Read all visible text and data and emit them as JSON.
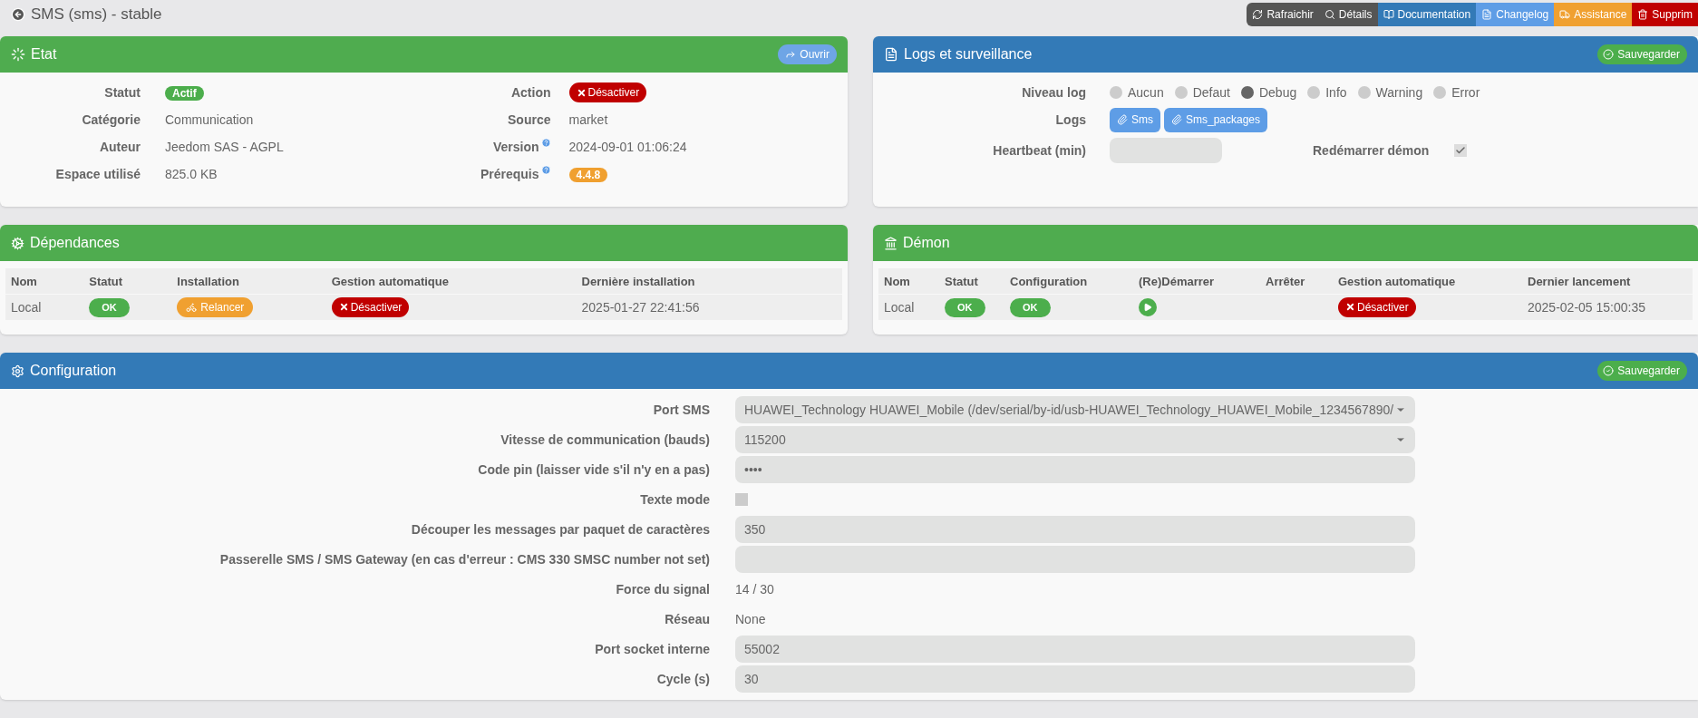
{
  "page": {
    "title": "SMS (sms) - stable"
  },
  "toolbar": [
    "Rafraichir",
    "Détails",
    "Documentation",
    "Changelog",
    "Assistance",
    "Supprim"
  ],
  "etat": {
    "title": "Etat",
    "open_button": "Ouvrir",
    "left": [
      {
        "label": "Statut",
        "value": "Actif",
        "kind": "badge-green"
      },
      {
        "label": "Catégorie",
        "value": "Communication",
        "kind": "text"
      },
      {
        "label": "Auteur",
        "value": "Jeedom SAS - AGPL",
        "kind": "text"
      },
      {
        "label": "Espace utilisé",
        "value": "825.0 KB",
        "kind": "text"
      }
    ],
    "right": [
      {
        "label": "Action",
        "value": "Désactiver",
        "kind": "button-red",
        "help": false
      },
      {
        "label": "Source",
        "value": "market",
        "kind": "text",
        "help": false
      },
      {
        "label": "Version",
        "value": "2024-09-01 01:06:24",
        "kind": "text",
        "help": true
      },
      {
        "label": "Prérequis",
        "value": "4.4.8",
        "kind": "badge-orange",
        "help": true
      }
    ]
  },
  "logs": {
    "title": "Logs et surveillance",
    "save_button": "Sauvegarder",
    "level_label": "Niveau log",
    "levels": [
      {
        "label": "Aucun",
        "selected": false
      },
      {
        "label": "Defaut",
        "selected": false
      },
      {
        "label": "Debug",
        "selected": true
      },
      {
        "label": "Info",
        "selected": false
      },
      {
        "label": "Warning",
        "selected": false
      },
      {
        "label": "Error",
        "selected": false
      }
    ],
    "logs_label": "Logs",
    "log_buttons": [
      "Sms",
      "Sms_packages"
    ],
    "heartbeat_label": "Heartbeat (min)",
    "restart_label": "Redémarrer démon",
    "restart_checked": true
  },
  "dependances": {
    "title": "Dépendances",
    "columns": [
      "Nom",
      "Statut",
      "Installation",
      "Gestion automatique",
      "Dernière installation"
    ],
    "row": [
      {
        "kind": "text",
        "value": "Local"
      },
      {
        "kind": "badge-green",
        "value": "OK"
      },
      {
        "kind": "button-orange",
        "value": "Relancer"
      },
      {
        "kind": "button-red",
        "value": "Désactiver"
      },
      {
        "kind": "text",
        "value": "2025-01-27 22:41:56"
      }
    ]
  },
  "demon": {
    "title": "Démon",
    "columns": [
      "Nom",
      "Statut",
      "Configuration",
      "(Re)Démarrer",
      "Arrêter",
      "Gestion automatique",
      "Dernier lancement"
    ],
    "row": [
      {
        "kind": "text",
        "value": "Local"
      },
      {
        "kind": "badge-green",
        "value": "OK"
      },
      {
        "kind": "badge-green",
        "value": "OK"
      },
      {
        "kind": "play"
      },
      {
        "kind": "empty"
      },
      {
        "kind": "button-red",
        "value": "Désactiver"
      },
      {
        "kind": "text",
        "value": "2025-02-05 15:00:35"
      }
    ]
  },
  "configuration": {
    "title": "Configuration",
    "save_button": "Sauvegarder",
    "fields": [
      {
        "label": "Port SMS",
        "kind": "select",
        "value": "HUAWEI_Technology HUAWEI_Mobile (/dev/serial/by-id/usb-HUAWEI_Technology_HUAWEI_Mobile_1234567890/"
      },
      {
        "label": "Vitesse de communication (bauds)",
        "kind": "select",
        "value": "115200"
      },
      {
        "label": "Code pin (laisser vide s'il n'y en a pas)",
        "kind": "input",
        "value": "••••"
      },
      {
        "label": "Texte mode",
        "kind": "checkbox",
        "checked": false
      },
      {
        "label": "Découper les messages par paquet de caractères",
        "kind": "input",
        "value": "350"
      },
      {
        "label": "Passerelle SMS / SMS Gateway (en cas d'erreur : CMS 330 SMSC number not set)",
        "kind": "input"
      },
      {
        "label": "Force du signal",
        "kind": "text",
        "value": "14 / 30"
      },
      {
        "label": "Réseau",
        "kind": "text",
        "value": "None"
      },
      {
        "label": "Port socket interne",
        "kind": "input",
        "value": "55002"
      },
      {
        "label": "Cycle (s)",
        "kind": "input",
        "value": "30"
      }
    ]
  }
}
